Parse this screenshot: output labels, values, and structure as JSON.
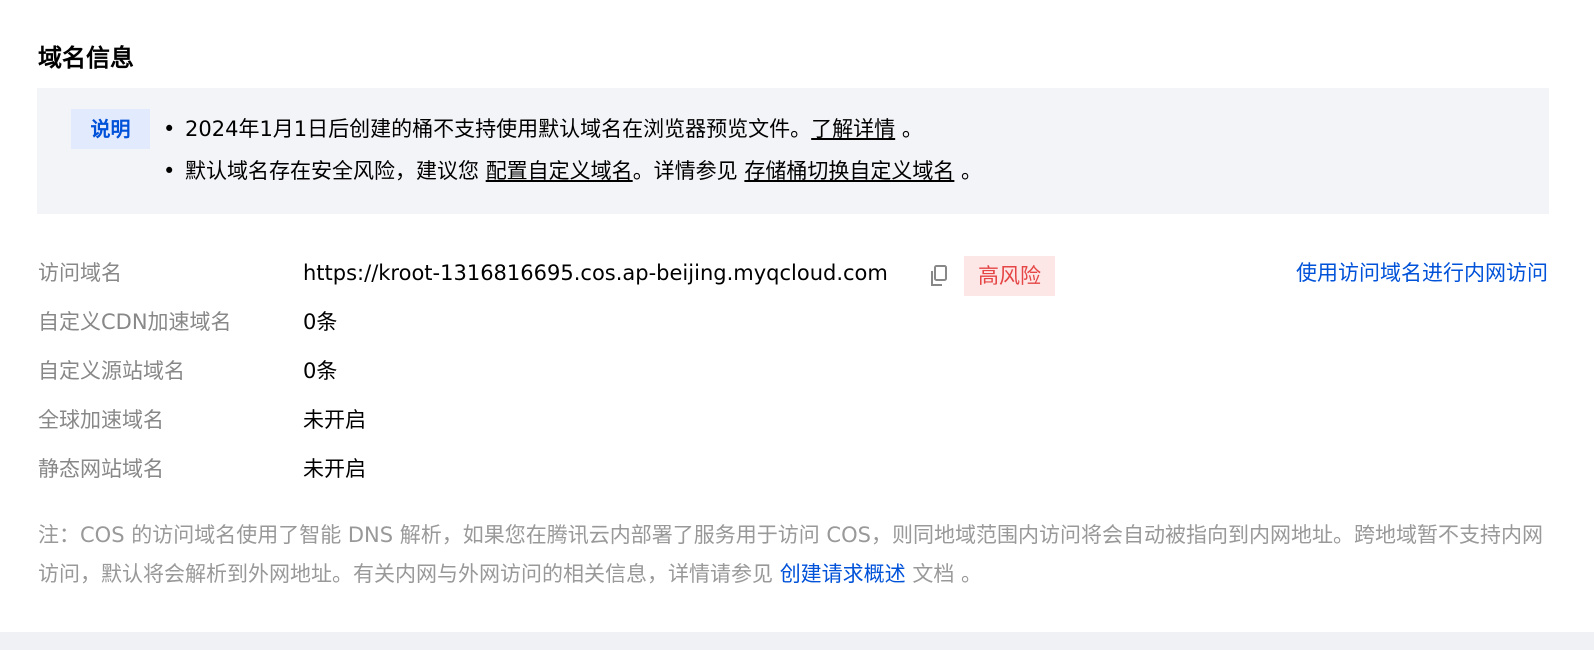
{
  "section": {
    "title": "域名信息"
  },
  "notice": {
    "tag": "说明",
    "line1": {
      "bullet": "•",
      "text": "2024年1月1日后创建的桶不支持使用默认域名在浏览器预览文件。",
      "link": "了解详情",
      "suffix": " 。"
    },
    "line2": {
      "bullet": "•",
      "text": "默认域名存在安全风险，建议您 ",
      "link1": "配置自定义域名",
      "middle": "。详情参见 ",
      "link2": "存储桶切换自定义域名",
      "suffix": " 。"
    }
  },
  "rows": [
    {
      "label": "访问域名",
      "value": "https://kroot-1316816695.cos.ap-beijing.myqcloud.com"
    },
    {
      "label": "自定义CDN加速域名",
      "value": "0条"
    },
    {
      "label": "自定义源站域名",
      "value": "0条"
    },
    {
      "label": "全球加速域名",
      "value": "未开启"
    },
    {
      "label": "静态网站域名",
      "value": "未开启"
    }
  ],
  "risk_badge": "高风险",
  "intranet_link": "使用访问域名进行内网访问",
  "note": {
    "text": "注：COS 的访问域名使用了智能 DNS 解析，如果您在腾讯云内部署了服务用于访问 COS，则同地域范围内访问将会自动被指向到内网地址。跨地域暂不支持内网访问，默认将会解析到外网地址。有关内网与外网访问的相关信息，详情请参见 ",
    "link": "创建请求概述",
    "suffix": " 文档 。"
  },
  "colors": {
    "accent": "#0052d9",
    "risk_text": "#e54545",
    "risk_bg": "#fde6e6",
    "notice_bg": "#f3f4f7",
    "tag_bg": "#e2ebfd",
    "label_gray": "#888888"
  },
  "icons": {
    "copy": "copy-icon"
  }
}
